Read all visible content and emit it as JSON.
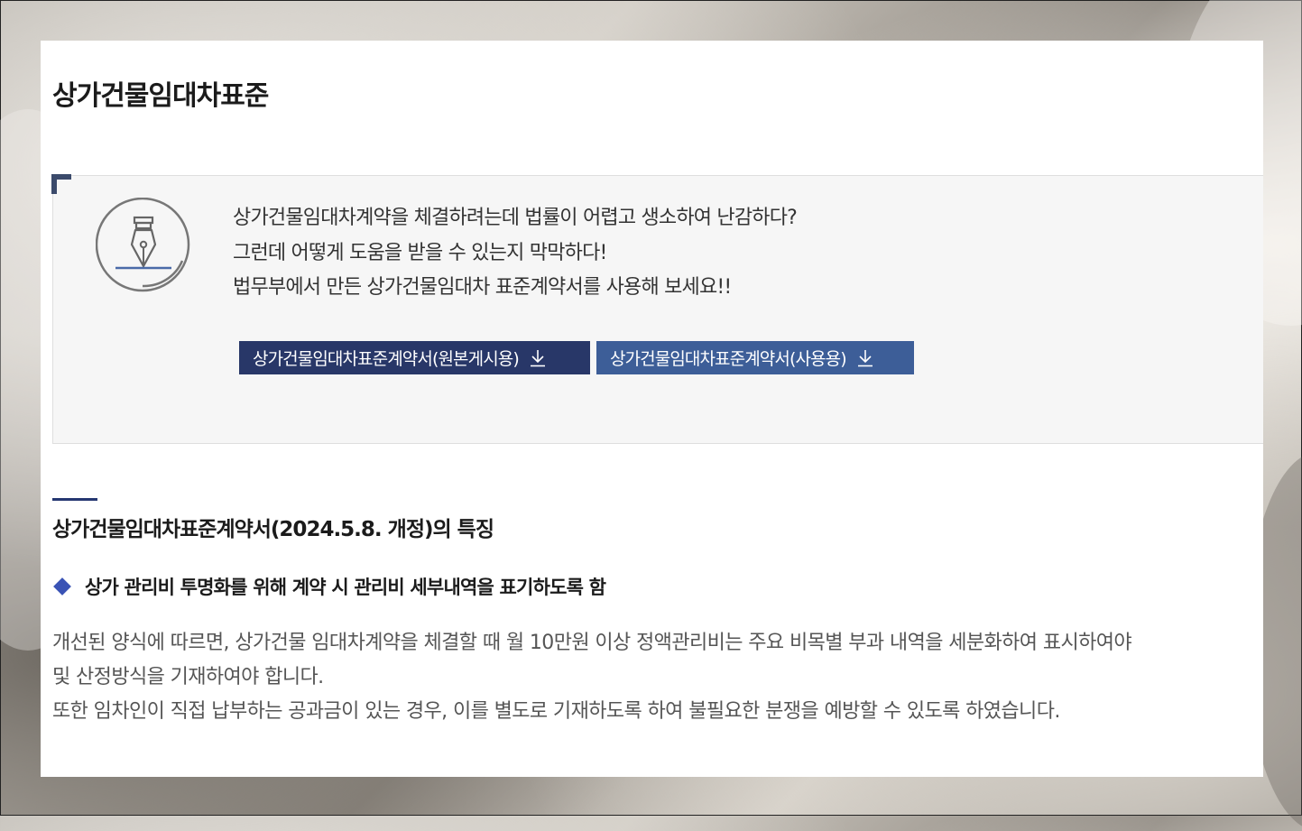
{
  "page": {
    "title": "상가건물임대차표준"
  },
  "intro": {
    "lines": [
      "상가건물임대차계약을 체결하려는데 법률이 어렵고 생소하여 난감하다?",
      "그런데 어떻게 도움을 받을 수 있는지 막막하다!",
      "법무부에서 만든 상가건물임대차 표준계약서를 사용해 보세요!!"
    ],
    "icon": "fountain-pen-icon"
  },
  "downloads": {
    "original_label": "상가건물임대차표준계약서(원본게시용)",
    "usage_label": "상가건물임대차표준계약서(사용용)",
    "icon": "download-icon"
  },
  "section": {
    "title": "상가건물임대차표준계약서(2024.5.8. 개정)의 특징",
    "feature": {
      "title": "상가 관리비 투명화를 위해 계약 시 관리비 세부내역을 표기하도록 함",
      "body_lines": [
        "개선된 양식에 따르면, 상가건물 임대차계약을 체결할 때 월 10만원 이상 정액관리비는 주요 비목별 부과 내역을 세분화하여 표시하여야",
        "및 산정방식을 기재하여야 합니다.",
        "또한 임차인이 직접 납부하는 공과금이 있는 경우, 이를 별도로 기재하도록 하여 불필요한 분쟁을 예방할 수 있도록 하였습니다."
      ]
    }
  },
  "colors": {
    "primary_dark": "#283768",
    "primary": "#3d5e98",
    "accent_diamond": "#3a53b5",
    "box_bg": "#f6f6f6"
  }
}
